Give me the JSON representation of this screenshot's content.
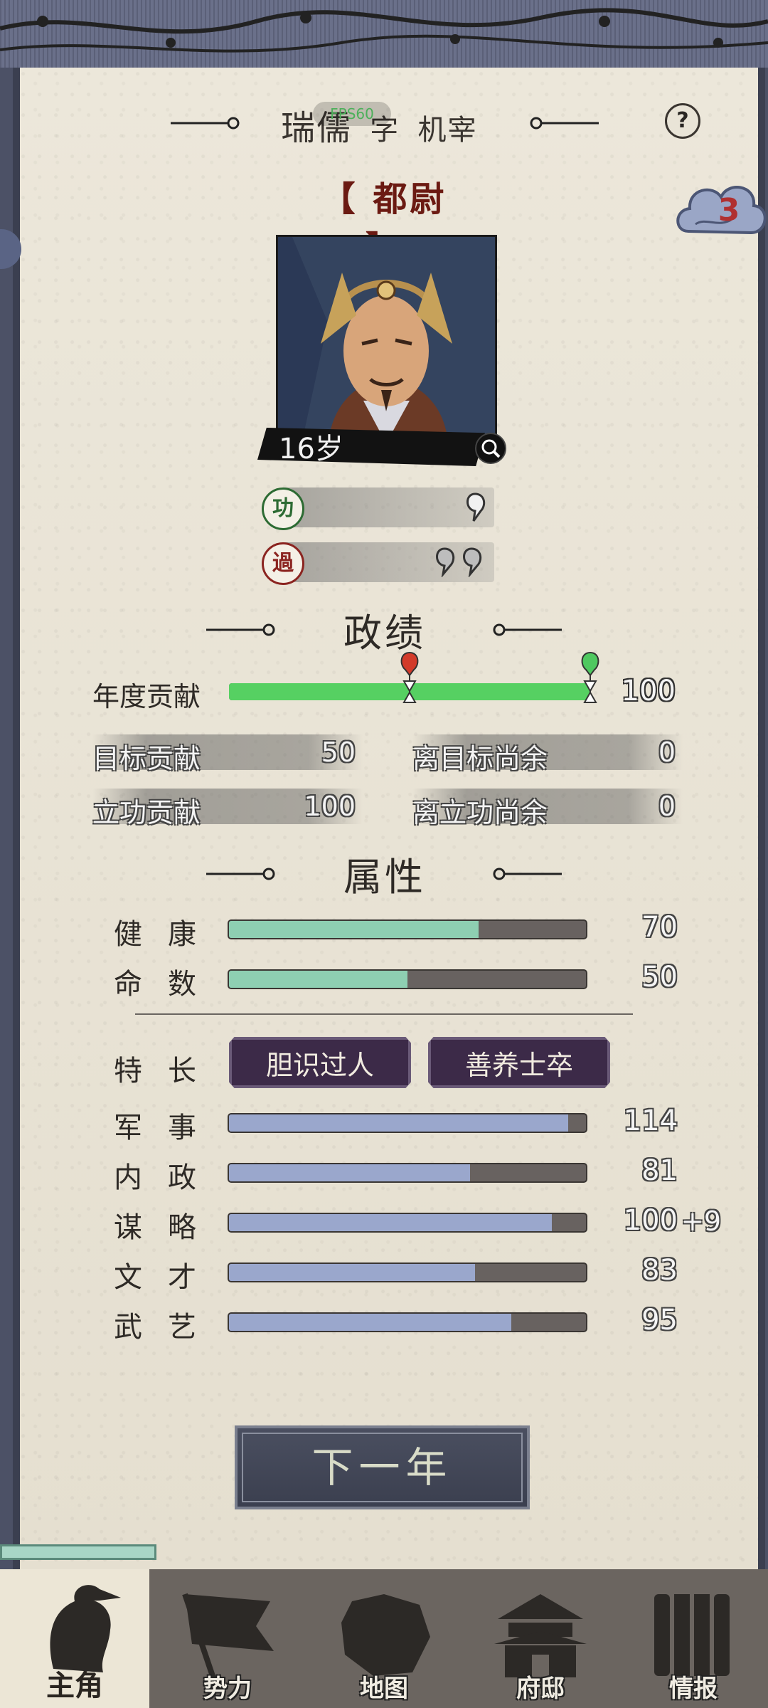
{
  "header": {
    "name": "瑞儒",
    "courtesy_label": "字",
    "courtesy_name": "机宰",
    "fps": "FPS60",
    "help_label": "?",
    "rank": "【 都尉 】",
    "cloud_count": "3"
  },
  "portrait": {
    "age": "16岁"
  },
  "merit": {
    "seal": "功"
  },
  "fault": {
    "seal": "過"
  },
  "performance": {
    "title": "政绩",
    "yearly_label": "年度贡献",
    "yearly_value": "100",
    "yearly_fraction": 1.0,
    "target_marker_fraction": 0.5,
    "target_label": "目标贡献",
    "target_value": "50",
    "to_target_label": "离目标尚余",
    "to_target_value": "0",
    "merit_label": "立功贡献",
    "merit_value": "100",
    "to_merit_label": "离立功尚余",
    "to_merit_value": "0"
  },
  "attributes": {
    "title": "属性",
    "health": {
      "label": "健康",
      "value": "70",
      "fraction": 0.7
    },
    "fate": {
      "label": "命数",
      "value": "50",
      "fraction": 0.5
    },
    "traits_label": "特长",
    "traits": [
      "胆识过人",
      "善养士卒"
    ],
    "abilities": [
      {
        "label": "军事",
        "value": "114",
        "bonus": "",
        "fraction": 0.95
      },
      {
        "label": "内政",
        "value": "81",
        "bonus": "",
        "fraction": 0.675
      },
      {
        "label": "谋略",
        "value": "100",
        "bonus": "+9",
        "fraction": 0.905
      },
      {
        "label": "文才",
        "value": "83",
        "bonus": "",
        "fraction": 0.69
      },
      {
        "label": "武艺",
        "value": "95",
        "bonus": "",
        "fraction": 0.79
      }
    ]
  },
  "next_year_label": "下一年",
  "nav": [
    {
      "label": "主角",
      "icon": "protagonist-icon",
      "active": true
    },
    {
      "label": "势力",
      "icon": "faction-flag-icon",
      "active": false
    },
    {
      "label": "地图",
      "icon": "map-icon",
      "active": false
    },
    {
      "label": "府邸",
      "icon": "mansion-icon",
      "active": false
    },
    {
      "label": "情报",
      "icon": "intel-scroll-icon",
      "active": false
    }
  ]
}
